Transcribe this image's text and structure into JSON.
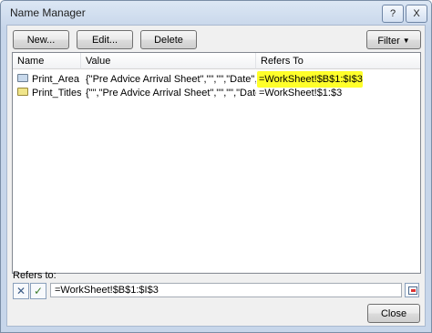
{
  "window": {
    "title": "Name Manager",
    "help_label": "?",
    "close_label": "X"
  },
  "toolbar": {
    "new_label": "New...",
    "edit_label": "Edit...",
    "delete_label": "Delete",
    "filter_label": "Filter",
    "filter_icon": "chevron-down-icon"
  },
  "list": {
    "columns": [
      "Name",
      "Value",
      "Refers To"
    ],
    "rows": [
      {
        "name": "Print_Area",
        "value": "{\"Pre Advice Arrival Sheet\",\"\",\"\",\"Date\",\"T...",
        "refers_to": "=WorkSheet!$B$1:$I$3",
        "icon": "defined-name-icon",
        "highlight_color": "#ffff2a"
      },
      {
        "name": "Print_Titles",
        "value": "{\"\",\"Pre Advice Arrival Sheet\",\"\",\"\",\"Date\",...",
        "refers_to": "=WorkSheet!$1:$3",
        "icon": "defined-name-icon"
      }
    ]
  },
  "refers_to": {
    "label": "Refers to:",
    "value": "=WorkSheet!$B$1:$I$3",
    "cancel_icon": "cancel-x-icon",
    "confirm_icon": "checkmark-icon",
    "collapse_icon": "collapse-dialog-icon"
  },
  "footer": {
    "close_label": "Close"
  }
}
